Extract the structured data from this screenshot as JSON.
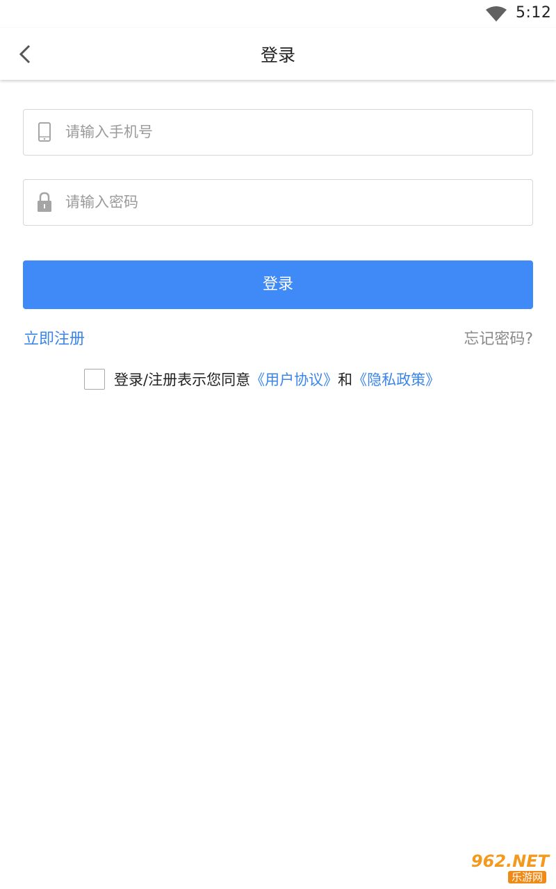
{
  "status_bar": {
    "time": "5:12",
    "wifi_icon": "wifi-icon"
  },
  "app_bar": {
    "title": "登录",
    "back_icon": "chevron-left-icon"
  },
  "form": {
    "phone": {
      "placeholder": "请输入手机号",
      "value": "",
      "icon": "phone-icon"
    },
    "password": {
      "placeholder": "请输入密码",
      "value": "",
      "icon": "lock-icon"
    },
    "login_button": "登录"
  },
  "links": {
    "register": "立即注册",
    "forgot_password": "忘记密码?"
  },
  "agreement": {
    "checked": false,
    "prefix": "登录/注册表示您同意",
    "user_agreement": "《用户协议》",
    "and": "和",
    "privacy_policy": "《隐私政策》"
  },
  "watermark": {
    "top": "962.NET",
    "bottom": "乐游网"
  },
  "colors": {
    "accent": "#3f8af7",
    "link": "#3a86e8",
    "muted": "#8a8a8a",
    "border": "#d6d6d6"
  }
}
